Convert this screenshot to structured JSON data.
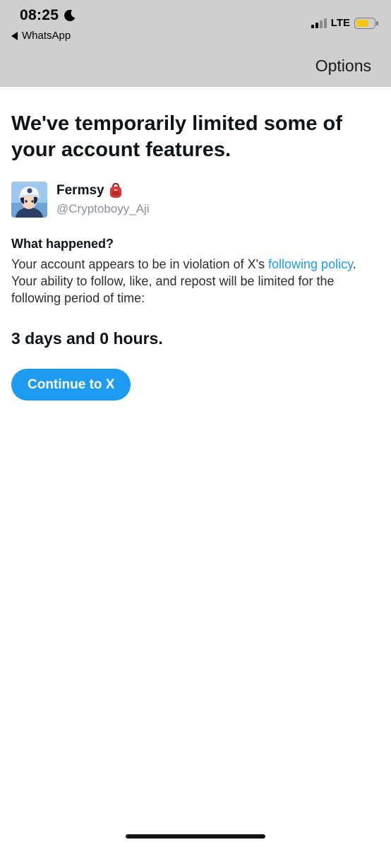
{
  "status_bar": {
    "time": "08:25",
    "back_app": "WhatsApp",
    "network": "LTE",
    "battery_level": 0.7,
    "battery_color": "#f5c518"
  },
  "nav": {
    "options_label": "Options"
  },
  "main": {
    "headline": "We've temporarily limited some of your account features.",
    "user": {
      "display_name": "Fermsy",
      "handle": "@Cryptoboyy_Aji",
      "name_emoji_icon": "backpack-icon"
    },
    "section_title": "What happened?",
    "body_before_link": "Your account appears to be in violation of X's ",
    "link_text": "following policy",
    "body_after_link": ". Your ability to follow, like, and repost will be limited for the following period of time:",
    "duration": "3 days and 0 hours.",
    "continue_label": "Continue to X"
  },
  "colors": {
    "accent": "#1d9bf0",
    "header_bg": "#cfcfcf"
  }
}
